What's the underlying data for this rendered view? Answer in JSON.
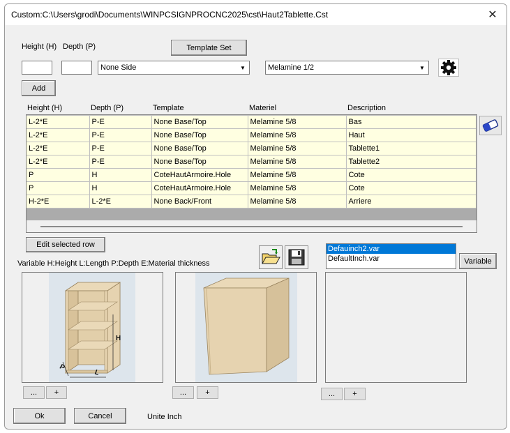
{
  "window": {
    "title": "Custom:C:\\Users\\grodi\\Documents\\WINPCSIGNPROCNC2025\\cst\\Haut2Tablette.Cst",
    "close_glyph": "✕"
  },
  "inputs": {
    "height_label": "Height (H)",
    "depth_label": "Depth (P)",
    "template_set_button": "Template Set",
    "height_value": "",
    "depth_value": "",
    "side_combo": "None Side",
    "material_combo": "Melamine 1/2",
    "add_button": "Add"
  },
  "grid": {
    "columns": [
      "Height (H)",
      "Depth (P)",
      "Template",
      "Materiel",
      "Description"
    ],
    "rows": [
      [
        "L-2*E",
        "P-E",
        "None Base/Top",
        "Melamine 5/8",
        "Bas"
      ],
      [
        "L-2*E",
        "P-E",
        "None Base/Top",
        "Melamine 5/8",
        "Haut"
      ],
      [
        "L-2*E",
        "P-E",
        "None Base/Top",
        "Melamine 5/8",
        "Tablette1"
      ],
      [
        "L-2*E",
        "P-E",
        "None Base/Top",
        "Melamine 5/8",
        "Tablette2"
      ],
      [
        "P",
        "H",
        "CoteHautArmoire.Hole",
        "Melamine 5/8",
        "Cote"
      ],
      [
        "P",
        "H",
        "CoteHautArmoire.Hole",
        "Melamine 5/8",
        "Cote"
      ],
      [
        "H-2*E",
        "L-2*E",
        "None Back/Front",
        "Melamine 5/8",
        "Arriere"
      ]
    ]
  },
  "edit_selected_row_button": "Edit selected row",
  "variable_hint": "Variable H:Height L:Length P:Depth  E:Material thickness",
  "var_list": {
    "items": [
      "Defauinch2.var",
      "DefaultInch.var"
    ],
    "selected": 0
  },
  "variable_button": "Variable",
  "panel_buttons": {
    "browse": "...",
    "add": "+"
  },
  "figure_labels": {
    "height": "H",
    "depth": "P",
    "length": "L"
  },
  "footer": {
    "ok_button": "Ok",
    "cancel_button": "Cancel",
    "units_text": "Unite Inch"
  },
  "colors": {
    "grid_row_bg": "#ffffe1",
    "list_selection": "#0078d7",
    "wood": "#e6d3b0"
  },
  "icons": {
    "gear": "gear-icon",
    "eraser": "eraser-icon",
    "open": "open-folder-icon",
    "save": "floppy-disk-icon"
  }
}
